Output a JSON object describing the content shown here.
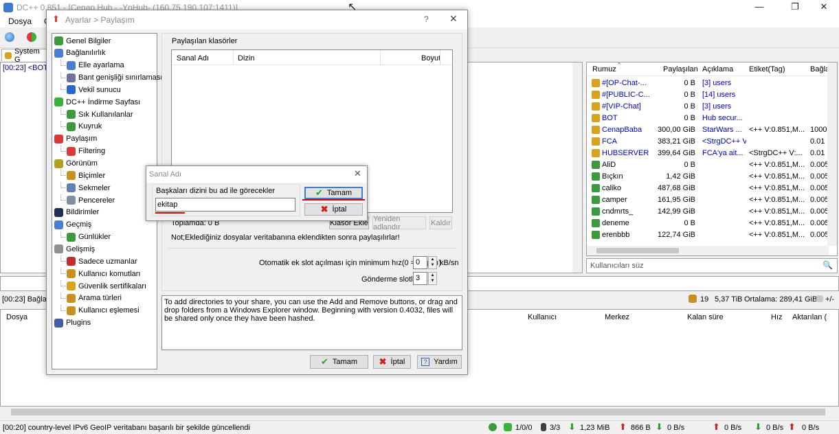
{
  "main": {
    "title": "DC++ 0.851 - [Cenap Hub - -YnHub- (160.75.190.107:1411)]",
    "menu": [
      "Dosya",
      "G"
    ],
    "tab_label": "System G",
    "chat_line": "[00:23] <BOT>",
    "hub_status": "[00:23] Bağlan",
    "hub_stats": {
      "users": "19",
      "shared": "5,37 TiB",
      "average": "Ortalama: 289,41 GiB",
      "extra": "+/-"
    },
    "user_filter_placeholder": "Kullanıcıları süz",
    "user_columns": [
      "Rumuz",
      "Paylaşılan",
      "Açıklama",
      "Etiket(Tag)",
      "Bağla"
    ],
    "users": [
      {
        "nick": "#[OP-Chat-...",
        "share": "0 B",
        "desc": "[3] users",
        "tag": "",
        "conn": "",
        "icon": "#d8a21e",
        "link": true
      },
      {
        "nick": "#[PUBLIC-C...",
        "share": "0 B",
        "desc": "[14] users",
        "tag": "",
        "conn": "",
        "icon": "#d8a21e",
        "link": true
      },
      {
        "nick": "#[VIP-Chat]",
        "share": "0 B",
        "desc": "[3] users",
        "tag": "",
        "conn": "",
        "icon": "#d8a21e",
        "link": true
      },
      {
        "nick": "BOT",
        "share": "0 B",
        "desc": "Hub secur...",
        "tag": "",
        "conn": "",
        "icon": "#d8a21e",
        "link": true
      },
      {
        "nick": "CenapBaba",
        "share": "300,00 GiB",
        "desc": "StarWars ...",
        "tag": "<++ V:0.851,M...",
        "conn": "1000",
        "icon": "#d8a21e",
        "link": true
      },
      {
        "nick": "FCA",
        "share": "383,21 GiB",
        "desc": "<StrgDC++ V:...",
        "tag": "",
        "conn": "0.01",
        "icon": "#d8a21e",
        "link": true
      },
      {
        "nick": "HUBSERVER",
        "share": "399,64 GiB",
        "desc": "FCA'ya ait...",
        "tag": "<StrgDC++ V:...",
        "conn": "0.01",
        "icon": "#d8a21e",
        "link": true
      },
      {
        "nick": "AliD",
        "share": "0 B",
        "desc": "",
        "tag": "<++ V:0.851,M...",
        "conn": "0.005",
        "icon": "#3c9a3c",
        "link": false
      },
      {
        "nick": "Bıçkın",
        "share": "1,42 GiB",
        "desc": "",
        "tag": "<++ V:0.851,M...",
        "conn": "0.005",
        "icon": "#3c9a3c",
        "link": false
      },
      {
        "nick": "caliko",
        "share": "487,68 GiB",
        "desc": "",
        "tag": "<++ V:0.851,M...",
        "conn": "0.005",
        "icon": "#3c9a3c",
        "link": false
      },
      {
        "nick": "camper",
        "share": "161,95 GiB",
        "desc": "",
        "tag": "<++ V:0.851,M...",
        "conn": "0.005",
        "icon": "#3c9a3c",
        "link": false
      },
      {
        "nick": "cndmrts_",
        "share": "142,99 GiB",
        "desc": "",
        "tag": "<++ V:0.851,M...",
        "conn": "0.005",
        "icon": "#3c9a3c",
        "link": false
      },
      {
        "nick": "deneme",
        "share": "0 B",
        "desc": "",
        "tag": "<++ V:0.851,M...",
        "conn": "0.005",
        "icon": "#3c9a3c",
        "link": false
      },
      {
        "nick": "erenbbb",
        "share": "122,74 GiB",
        "desc": "",
        "tag": "<++ V:0.851,M...",
        "conn": "0.005",
        "icon": "#3c9a3c",
        "link": false
      }
    ],
    "transfer_columns": [
      "Dosya",
      "Kullanıcı",
      "Merkez",
      "Kalan süre",
      "Hız",
      "Aktarılan ("
    ],
    "status_message": "[00:20] country-level IPv6 GeoIP veritabanı başarılı bir şekilde güncellendi",
    "status_items": {
      "slots": "1/0/0",
      "upload_slots": "3/3",
      "downloaded": "1,23 MiB",
      "uploaded": "866 B",
      "down_rate": "0 B/s",
      "up_rate": "0 B/s",
      "down_rate2": "0 B/s",
      "up_rate2": "0 B/s"
    }
  },
  "settings": {
    "title": "Ayarlar > Paylaşım",
    "help_glyph": "?",
    "tree": [
      {
        "label": "Genel Bilgiler",
        "depth": 0,
        "icon": "#3c9a3c"
      },
      {
        "label": "Bağlanılırlık",
        "depth": 0,
        "icon": "#4a7fd0"
      },
      {
        "label": "Elle ayarlama",
        "depth": 1,
        "icon": "#4a7fd0"
      },
      {
        "label": "Bant genişliği sınırlaması",
        "depth": 1,
        "icon": "#7070a0"
      },
      {
        "label": "Vekil sunucu",
        "depth": 1,
        "icon": "#2a64c8"
      },
      {
        "label": "DC++ İndirme Sayfası",
        "depth": 0,
        "icon": "#3cb23c"
      },
      {
        "label": "Sık Kullanılanlar",
        "depth": 1,
        "icon": "#3c9a3c"
      },
      {
        "label": "Kuyruk",
        "depth": 1,
        "icon": "#3c9a3c"
      },
      {
        "label": "Paylaşım",
        "depth": 0,
        "icon": "#d83a3a"
      },
      {
        "label": "Filtering",
        "depth": 1,
        "icon": "#d83a3a"
      },
      {
        "label": "Görünüm",
        "depth": 0,
        "icon": "#b0a020"
      },
      {
        "label": "Biçimler",
        "depth": 1,
        "icon": "#c89020"
      },
      {
        "label": "Sekmeler",
        "depth": 1,
        "icon": "#6080b0"
      },
      {
        "label": "Pencereler",
        "depth": 1,
        "icon": "#8090a0"
      },
      {
        "label": "Bildirimler",
        "depth": 0,
        "icon": "#203050"
      },
      {
        "label": "Geçmiş",
        "depth": 0,
        "icon": "#4a7fd0"
      },
      {
        "label": "Günlükler",
        "depth": 1,
        "icon": "#3c9a3c"
      },
      {
        "label": "Gelişmiş",
        "depth": 0,
        "icon": "#909090"
      },
      {
        "label": "Sadece uzmanlar",
        "depth": 1,
        "icon": "#c03030"
      },
      {
        "label": "Kullanıcı komutları",
        "depth": 1,
        "icon": "#c89020"
      },
      {
        "label": "Güvenlik sertifikaları",
        "depth": 1,
        "icon": "#d8a21e"
      },
      {
        "label": "Arama türleri",
        "depth": 1,
        "icon": "#c89020"
      },
      {
        "label": "Kullanıcı eşlemesi",
        "depth": 1,
        "icon": "#c89020"
      },
      {
        "label": "Plugins",
        "depth": 0,
        "icon": "#4060a0"
      }
    ],
    "group_title": "Paylaşılan klasörler",
    "columns": [
      "Sanal Adı",
      "Dizin",
      "Boyut"
    ],
    "total": "Toplamda: 0 B",
    "btn_add": "Klasör Ekle",
    "btn_rename": "Yeniden adlandır",
    "btn_remove": "Kaldır",
    "note": "Not;Eklediğiniz dosyalar  veritabanına eklendikten sonra paylaşılırlar!",
    "auto_slot_label": "Otomatik ek slot açılması için minimum hız(0 = Kapalı)",
    "auto_slot_value": "0",
    "auto_slot_unit": "kB/sn",
    "upload_slots_label": "Gönderme slotları",
    "upload_slots_value": "3",
    "info": "To add directories to your share, you can use the Add and Remove buttons, or drag and drop folders from a Windows Explorer window. Beginning with version 0.4032, files will be shared only once they have been hashed.",
    "ok": "Tamam",
    "cancel": "İptal",
    "help": "Yardım"
  },
  "virtual_name_dialog": {
    "title": "Sanal Adı",
    "prompt": "Başkaları dizini bu ad ile görecekler",
    "value": "ekitap",
    "ok": "Tamam",
    "cancel": "İptal"
  },
  "colors": {
    "highlight_underline": "#e00000",
    "link_blue": "#0000c0",
    "ok_green": "#2e9e2e",
    "cancel_red": "#d02020"
  }
}
